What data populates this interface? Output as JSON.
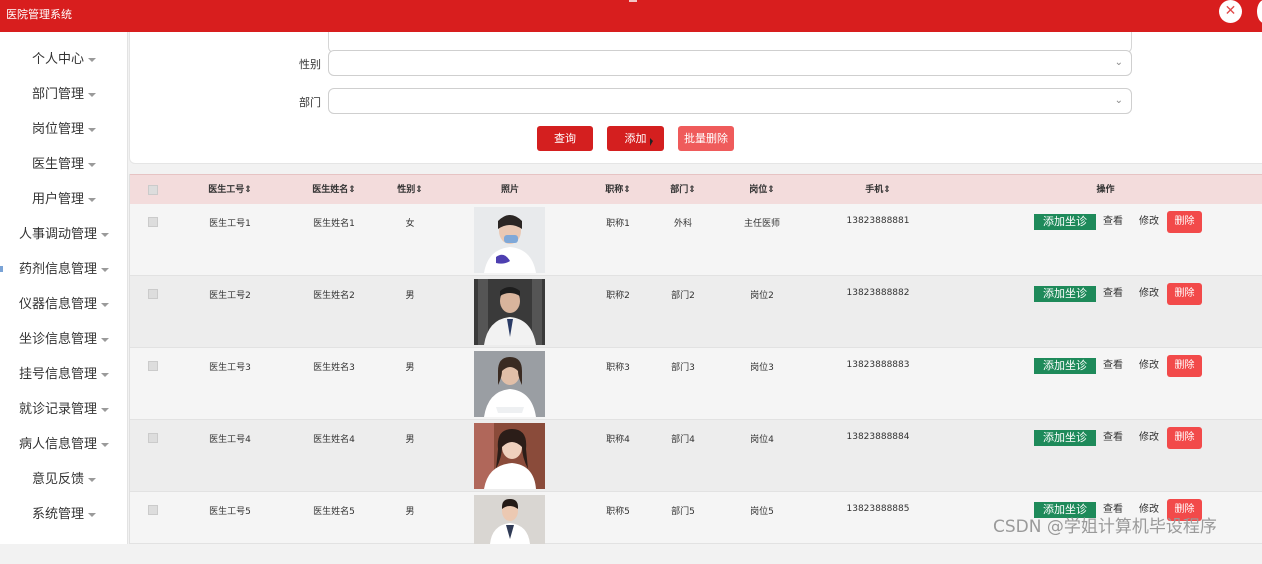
{
  "app": {
    "title": "医院管理系统",
    "close_glyph": "✕"
  },
  "sidebar": {
    "items": [
      {
        "label": "个人中心"
      },
      {
        "label": "部门管理"
      },
      {
        "label": "岗位管理"
      },
      {
        "label": "医生管理"
      },
      {
        "label": "用户管理"
      },
      {
        "label": "人事调动管理"
      },
      {
        "label": "药剂信息管理"
      },
      {
        "label": "仪器信息管理"
      },
      {
        "label": "坐诊信息管理"
      },
      {
        "label": "挂号信息管理"
      },
      {
        "label": "就诊记录管理"
      },
      {
        "label": "病人信息管理"
      },
      {
        "label": "意见反馈"
      },
      {
        "label": "系统管理"
      }
    ]
  },
  "search": {
    "gender_label": "性别",
    "department_label": "部门",
    "gender_value": "",
    "department_value": "",
    "query_button": "查询",
    "add_button": "添加",
    "batch_delete_button": "批量删除"
  },
  "table": {
    "headers": {
      "doctor_id": "医生工号",
      "doctor_name": "医生姓名",
      "gender": "性别",
      "photo": "照片",
      "title": "职称",
      "department": "部门",
      "position": "岗位",
      "phone": "手机",
      "actions": "操作"
    },
    "sort_glyph": "⇕",
    "action_labels": {
      "add_consult": "添加坐诊",
      "view": "查看",
      "edit": "修改",
      "delete": "删除"
    },
    "rows": [
      {
        "doctor_id": "医生工号1",
        "doctor_name": "医生姓名1",
        "gender": "女",
        "title": "职称1",
        "department": "外科",
        "position": "主任医师",
        "phone": "13823888881"
      },
      {
        "doctor_id": "医生工号2",
        "doctor_name": "医生姓名2",
        "gender": "男",
        "title": "职称2",
        "department": "部门2",
        "position": "岗位2",
        "phone": "13823888882"
      },
      {
        "doctor_id": "医生工号3",
        "doctor_name": "医生姓名3",
        "gender": "男",
        "title": "职称3",
        "department": "部门3",
        "position": "岗位3",
        "phone": "13823888883"
      },
      {
        "doctor_id": "医生工号4",
        "doctor_name": "医生姓名4",
        "gender": "男",
        "title": "职称4",
        "department": "部门4",
        "position": "岗位4",
        "phone": "13823888884"
      },
      {
        "doctor_id": "医生工号5",
        "doctor_name": "医生姓名5",
        "gender": "男",
        "title": "职称5",
        "department": "部门5",
        "position": "岗位5",
        "phone": "13823888885"
      }
    ]
  },
  "watermark": "CSDN @学姐计算机毕设程序",
  "colors": {
    "primary_red": "#d81e1e",
    "delete_red": "#f24a4a",
    "action_green": "#1e8a5a",
    "header_pink": "#f3dcdc"
  }
}
